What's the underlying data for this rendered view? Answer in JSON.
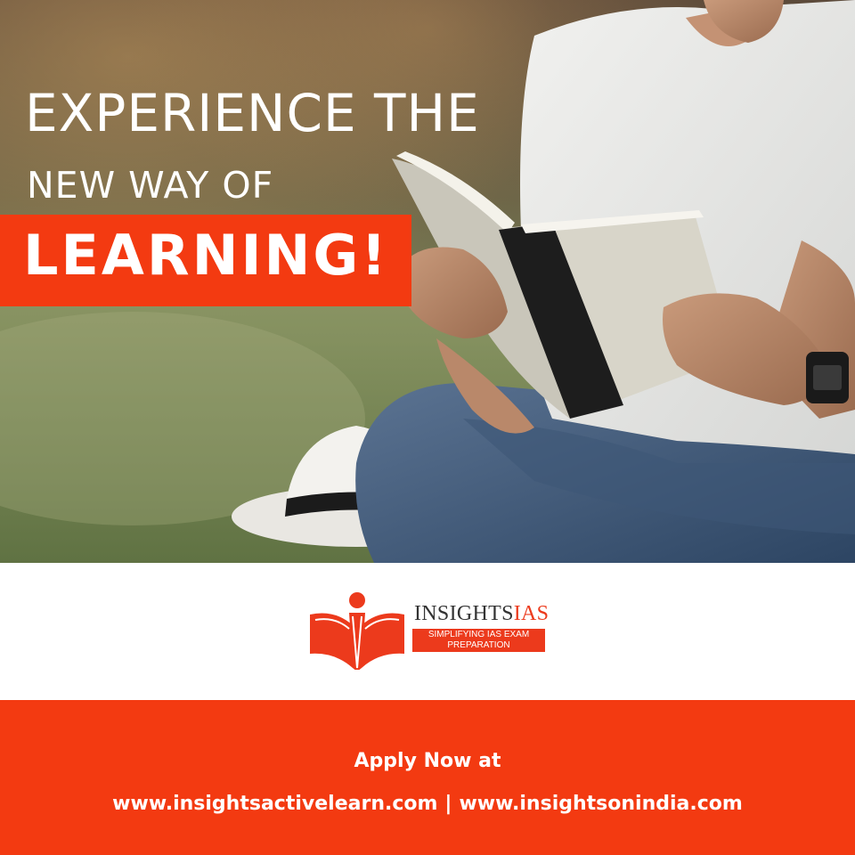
{
  "headline": {
    "line1": "EXPERIENCE THE",
    "line2": "NEW WAY OF",
    "line3": "LEARNING!"
  },
  "brand": {
    "name_main": "INSIGHTS",
    "name_accent": "IAS",
    "tagline": "SIMPLIFYING IAS EXAM PREPARATION",
    "logo_icon": "open-book-with-person-icon"
  },
  "footer": {
    "apply_text": "Apply Now at",
    "link1": "www.insightsactivelearn.com",
    "separator": "|",
    "link2": "www.insightsonindia.com"
  },
  "colors": {
    "accent": "#f33a11",
    "logo_red": "#ec3a1c",
    "headline_text": "#ffffff"
  }
}
